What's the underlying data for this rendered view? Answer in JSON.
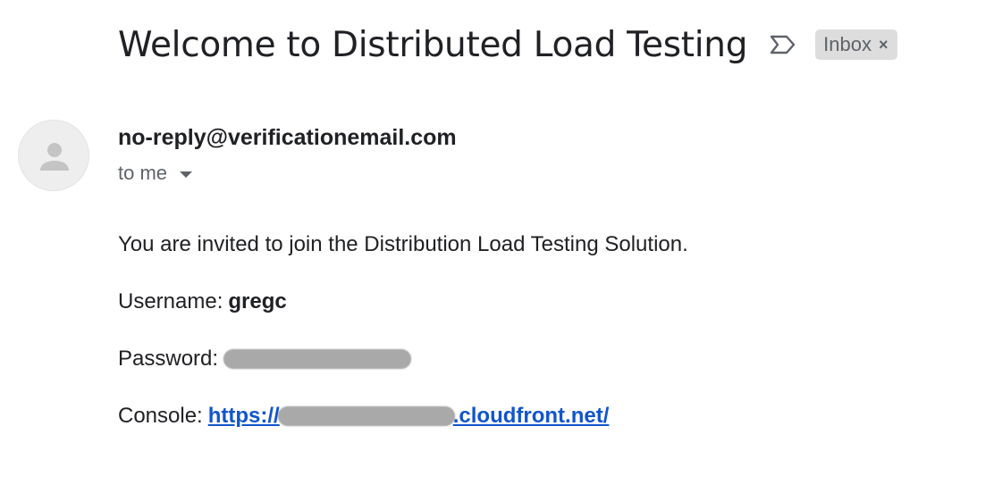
{
  "email": {
    "subject": "Welcome to Distributed Load Testing",
    "important_marker_icon": "label-important-icon",
    "label": {
      "text": "Inbox",
      "remove_glyph": "×"
    },
    "sender": {
      "avatar_icon": "person-icon",
      "address": "no-reply@verificationemail.com"
    },
    "recipient": {
      "text": "to me",
      "caret_icon": "caret-down-icon"
    },
    "body": {
      "invitation_text": "You are invited to join the Distribution Load Testing Solution.",
      "username_label": "Username:",
      "username_value": "gregc",
      "password_label": "Password:",
      "console_label": "Console:",
      "console_link_prefix": "https://",
      "console_link_suffix": ".cloudfront.net/"
    }
  },
  "colors": {
    "text_primary": "#202124",
    "text_secondary": "#5f6368",
    "link": "#1155cc",
    "chip_background": "#dddddd",
    "redaction": "#a9a9a9"
  }
}
